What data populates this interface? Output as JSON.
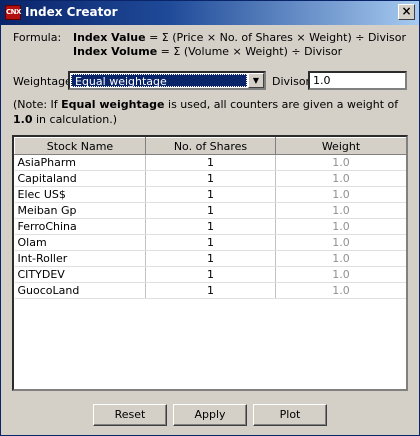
{
  "window": {
    "title": "Index Creator",
    "icon_text": "CNX",
    "close_glyph": "×"
  },
  "formula": {
    "label": "Formula:",
    "line1_bold": "Index Value",
    "line1_rest": " = Σ (Price × No. of Shares × Weight) ÷ Divisor",
    "line2_bold": "Index Volume",
    "line2_rest": " = Σ (Volume × Weight) ÷ Divisor"
  },
  "weightage": {
    "label": "Weightage",
    "selected": "Equal weightage",
    "arrow": "▼"
  },
  "divisor": {
    "label": "Divisor",
    "value": "1.0"
  },
  "note": {
    "part1": "(Note: If ",
    "bold1": "Equal weightage",
    "part2": " is used, all counters are given a weight of ",
    "bold2": "1.0",
    "part3": " in calculation.)"
  },
  "table": {
    "headers": [
      "Stock Name",
      "No. of Shares",
      "Weight"
    ],
    "rows": [
      [
        "AsiaPharm",
        "1",
        "1.0"
      ],
      [
        "Capitaland",
        "1",
        "1.0"
      ],
      [
        "Elec US$",
        "1",
        "1.0"
      ],
      [
        "Meiban Gp",
        "1",
        "1.0"
      ],
      [
        "FerroChina",
        "1",
        "1.0"
      ],
      [
        "Olam",
        "1",
        "1.0"
      ],
      [
        "Int-Roller",
        "1",
        "1.0"
      ],
      [
        "CITYDEV",
        "1",
        "1.0"
      ],
      [
        "GuocoLand",
        "1",
        "1.0"
      ]
    ]
  },
  "buttons": {
    "reset": "Reset",
    "apply": "Apply",
    "plot": "Plot"
  },
  "colors": {
    "title_bar": "#0a246a",
    "selection": "#0a246a",
    "window_bg": "#d4d0c8"
  }
}
